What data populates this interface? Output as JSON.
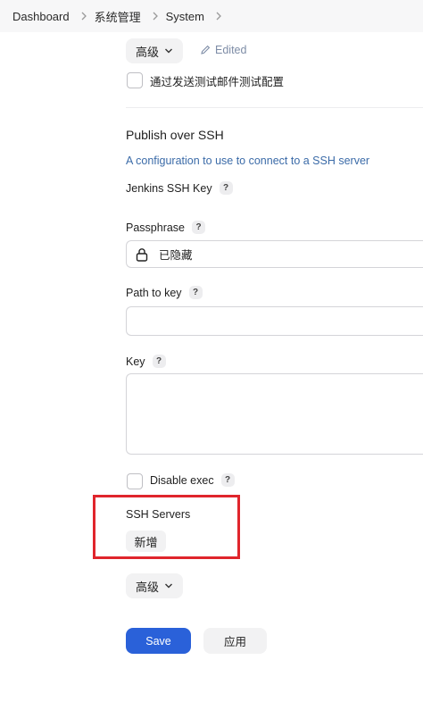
{
  "breadcrumb": {
    "items": [
      "Dashboard",
      "系统管理",
      "System"
    ]
  },
  "advanced_top": {
    "label": "高级"
  },
  "edited_label": "Edited",
  "send_test_mail_label": "通过发送测试邮件测试配置",
  "section": {
    "title": "Publish over SSH",
    "description": "A configuration to use to connect to a SSH server"
  },
  "jenkins_ssh_key": {
    "label": "Jenkins SSH Key"
  },
  "passphrase": {
    "label": "Passphrase",
    "value": "已隐藏"
  },
  "path_to_key": {
    "label": "Path to key",
    "value": ""
  },
  "key": {
    "label": "Key",
    "value": ""
  },
  "disable_exec": {
    "label": "Disable exec",
    "checked": false
  },
  "ssh_servers": {
    "label": "SSH Servers",
    "add_label": "新增"
  },
  "advanced_bottom": {
    "label": "高级"
  },
  "actions": {
    "save": "Save",
    "apply": "应用"
  },
  "help_char": "?",
  "colors": {
    "primary": "#2a61d9",
    "highlight": "#e0252c",
    "link": "#3b6ba8"
  }
}
